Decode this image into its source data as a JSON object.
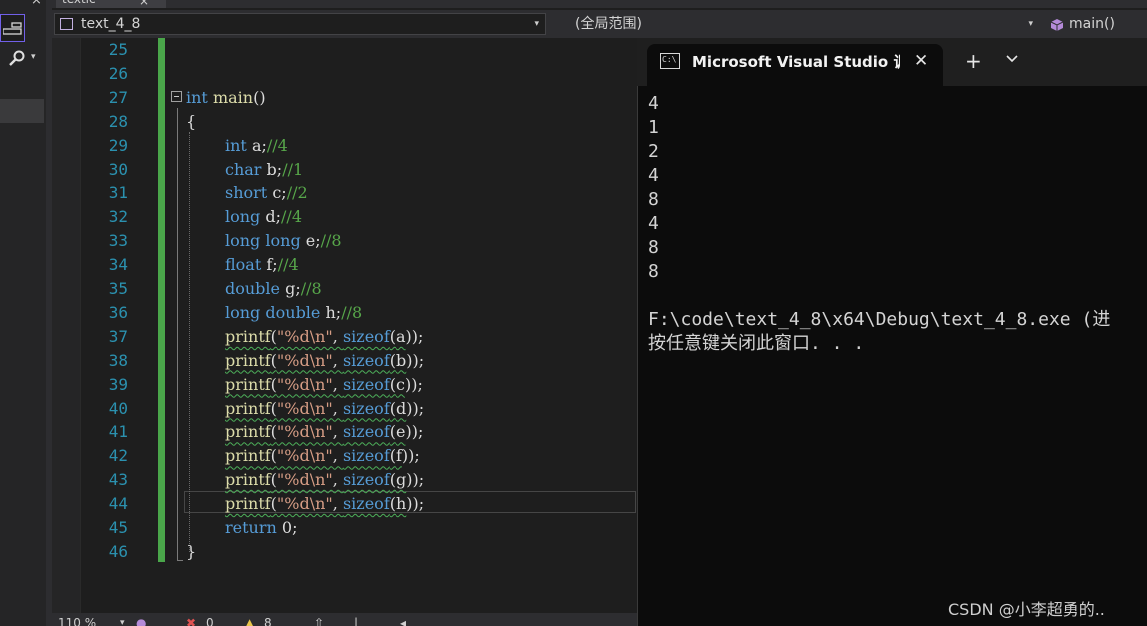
{
  "window": {
    "top_tab_label": "textic",
    "top_tab_close": "×"
  },
  "left_panel": {
    "close_glyph": "×",
    "dropdown_glyph": "▾"
  },
  "navbar": {
    "project": "text_4_8",
    "scope": "(全局范围)",
    "member": "main()",
    "dropdown_glyph": "▾"
  },
  "editor": {
    "line_numbers": [
      "25",
      "26",
      "27",
      "28",
      "29",
      "30",
      "31",
      "32",
      "33",
      "34",
      "35",
      "36",
      "37",
      "38",
      "39",
      "40",
      "41",
      "42",
      "43",
      "44",
      "45",
      "46"
    ],
    "code": {
      "main_kw": "int",
      "main_fn": " main",
      "main_paren": "()",
      "open_brace": "{",
      "close_brace": "}",
      "decls": [
        {
          "type": "int",
          "var": "a",
          "comment": "//4"
        },
        {
          "type": "char",
          "var": "b",
          "comment": "//1"
        },
        {
          "type": "short",
          "var": "c",
          "comment": "//2"
        },
        {
          "type": "long",
          "var": "d",
          "comment": "//4"
        },
        {
          "type": "long long",
          "var": "e",
          "comment": "//8"
        },
        {
          "type": "float",
          "var": "f",
          "comment": "//4"
        },
        {
          "type": "double",
          "var": "g",
          "comment": "//8"
        },
        {
          "type": "long double",
          "var": "h",
          "comment": "//8"
        }
      ],
      "printf_fn": "printf",
      "printf_str": "\"%d\\n\"",
      "sizeof_kw": "sizeof",
      "printf_args": [
        "a",
        "b",
        "c",
        "d",
        "e",
        "f",
        "g",
        "h"
      ],
      "return_kw": "return",
      "return_val": " 0;"
    }
  },
  "status_bar": {
    "zoom": "110 %",
    "errors": "0",
    "warnings": "8"
  },
  "console": {
    "tab_title": "Microsoft Visual Studio 调试控制台",
    "tab_icon_text": "C:\\",
    "close_glyph": "✕",
    "add_glyph": "+",
    "output_lines": [
      "4",
      "1",
      "2",
      "4",
      "8",
      "4",
      "8",
      "8"
    ],
    "exit_line": "F:\\code\\text_4_8\\x64\\Debug\\text_4_8.exe (进",
    "press_key_line": "按任意键关闭此窗口. . ."
  },
  "watermark": "CSDN @小李超勇的.."
}
